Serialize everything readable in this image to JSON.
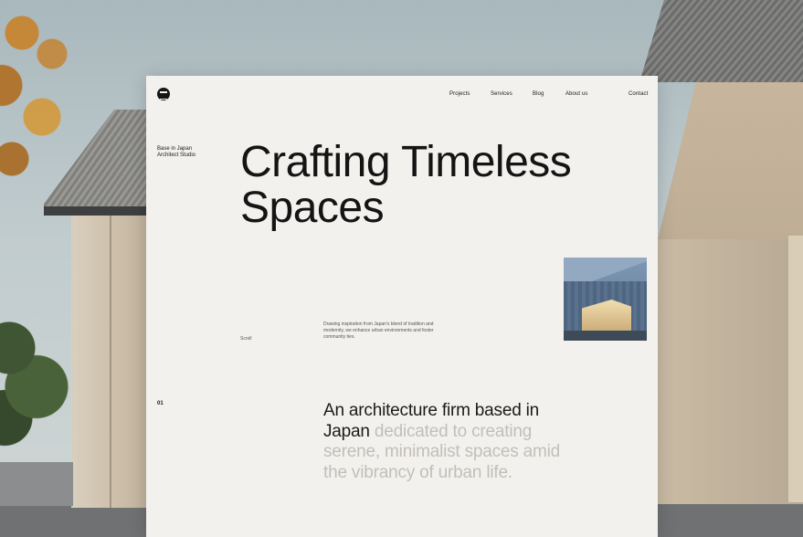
{
  "site": {
    "logo_icon": "torii-gate-icon",
    "nav": {
      "projects": "Projects",
      "services": "Services",
      "blog": "Blog",
      "about": "About us",
      "contact": "Contact"
    },
    "tagline_line1": "Base in Japan",
    "tagline_line2": "Architect Studio",
    "hero_line1": "Crafting Timeless",
    "hero_line2": "Spaces",
    "scroll_label": "Scroll",
    "description": "Drawing inspiration from Japan's blend of tradition and modernity, we enhance urban environments and foster community ties.",
    "section_number": "01",
    "statement_dark": "An architecture firm based in Japan",
    "statement_light": "dedicated to creating serene, minimalist spaces amid the vibrancy of urban life."
  },
  "colors": {
    "card_background": "#f3f1ee",
    "text_dark": "#141414",
    "text_muted": "#c2bfba"
  }
}
